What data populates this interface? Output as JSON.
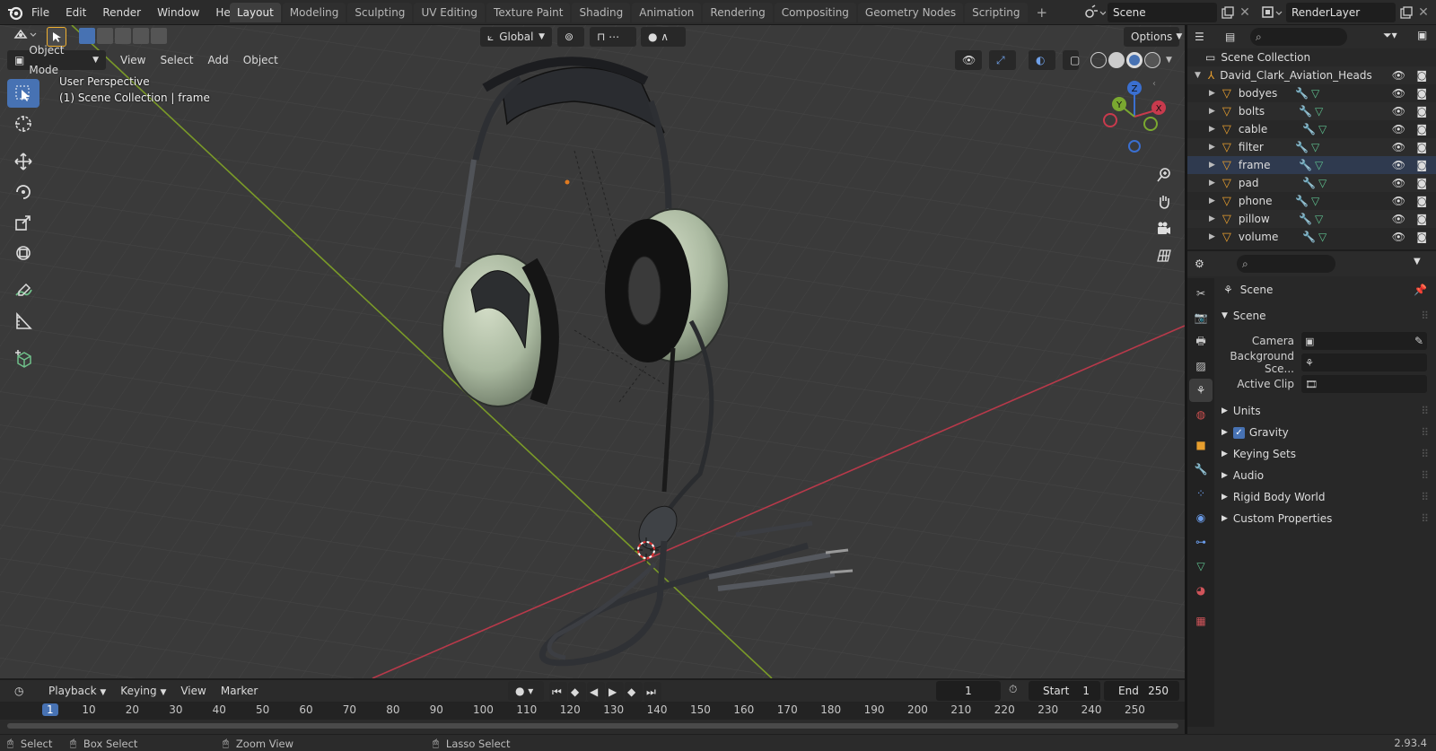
{
  "topbar": {
    "menus": [
      "File",
      "Edit",
      "Render",
      "Window",
      "Help"
    ],
    "workspaces": [
      "Layout",
      "Modeling",
      "Sculpting",
      "UV Editing",
      "Texture Paint",
      "Shading",
      "Animation",
      "Rendering",
      "Compositing",
      "Geometry Nodes",
      "Scripting"
    ],
    "active_workspace": "Layout",
    "scene_name": "Scene",
    "view_layer": "RenderLayer"
  },
  "viewport": {
    "transform_orientation": "Global",
    "options_label": "Options",
    "mode": "Object Mode",
    "menus": [
      "View",
      "Select",
      "Add",
      "Object"
    ],
    "perspective_label": "User Perspective",
    "collection_label": "(1) Scene Collection | frame",
    "gizmo_axes": {
      "z": "Z",
      "y": "Y",
      "x": "X"
    }
  },
  "outliner": {
    "root": "Scene Collection",
    "collection": "David_Clark_Aviation_Heads",
    "objects": [
      "bodyes",
      "bolts",
      "cable",
      "filter",
      "frame",
      "pad",
      "phone",
      "pillow",
      "volume"
    ],
    "selected": "frame"
  },
  "properties": {
    "header": "Scene",
    "panel": "Scene",
    "fields": [
      {
        "label": "Camera",
        "value": ""
      },
      {
        "label": "Background Sce...",
        "value": ""
      },
      {
        "label": "Active Clip",
        "value": ""
      }
    ],
    "collapsed_panels": [
      {
        "label": "Units",
        "checkbox": false
      },
      {
        "label": "Gravity",
        "checkbox": true
      },
      {
        "label": "Keying Sets",
        "checkbox": false
      },
      {
        "label": "Audio",
        "checkbox": false
      },
      {
        "label": "Rigid Body World",
        "checkbox": false
      },
      {
        "label": "Custom Properties",
        "checkbox": false
      }
    ]
  },
  "timeline": {
    "menus": [
      "Playback",
      "Keying",
      "View",
      "Marker"
    ],
    "current_frame": "1",
    "start_label": "Start",
    "start_value": "1",
    "end_label": "End",
    "end_value": "250",
    "ticks": [
      "1",
      "10",
      "20",
      "30",
      "40",
      "50",
      "60",
      "70",
      "80",
      "90",
      "100",
      "110",
      "120",
      "130",
      "140",
      "150",
      "160",
      "170",
      "180",
      "190",
      "200",
      "210",
      "220",
      "230",
      "240",
      "250"
    ]
  },
  "statusbar": {
    "items": [
      "Select",
      "Box Select",
      "Zoom View",
      "Lasso Select"
    ],
    "version": "2.93.4"
  },
  "colors": {
    "accent": "#4772b3",
    "axis_x": "#b8394a",
    "axis_y": "#7a9a28",
    "viewport_bg": "#3a3a3a"
  }
}
